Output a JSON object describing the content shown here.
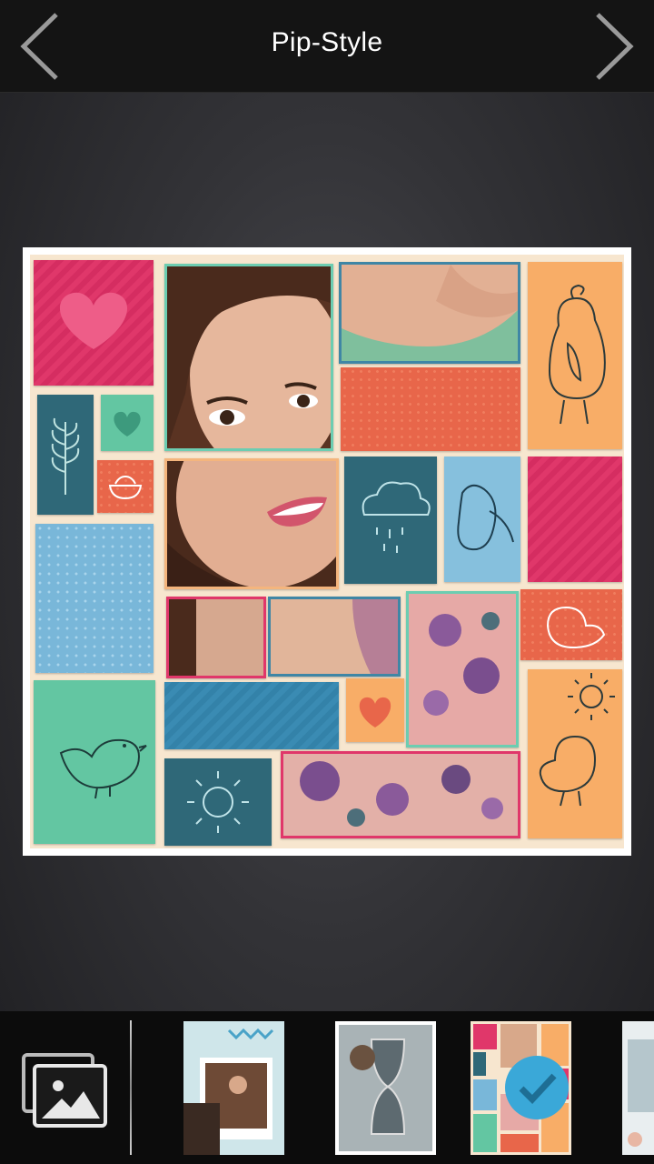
{
  "header": {
    "title": "Pip-Style",
    "back_icon": "chevron-left-icon",
    "next_icon": "chevron-right-icon"
  },
  "colors": {
    "topbar": "#141414",
    "bottombar": "#0c0c0c",
    "selected_check": "#3aa8d8"
  },
  "collage": {
    "template": "pip-style-patchwork",
    "frame": "white"
  },
  "bottom_bar": {
    "gallery_icon": "gallery-icon",
    "templates": [
      {
        "name": "bunting-frame"
      },
      {
        "name": "hourglass-frame"
      },
      {
        "name": "patchwork-frame",
        "selected": true
      },
      {
        "name": "partial-frame"
      }
    ]
  }
}
